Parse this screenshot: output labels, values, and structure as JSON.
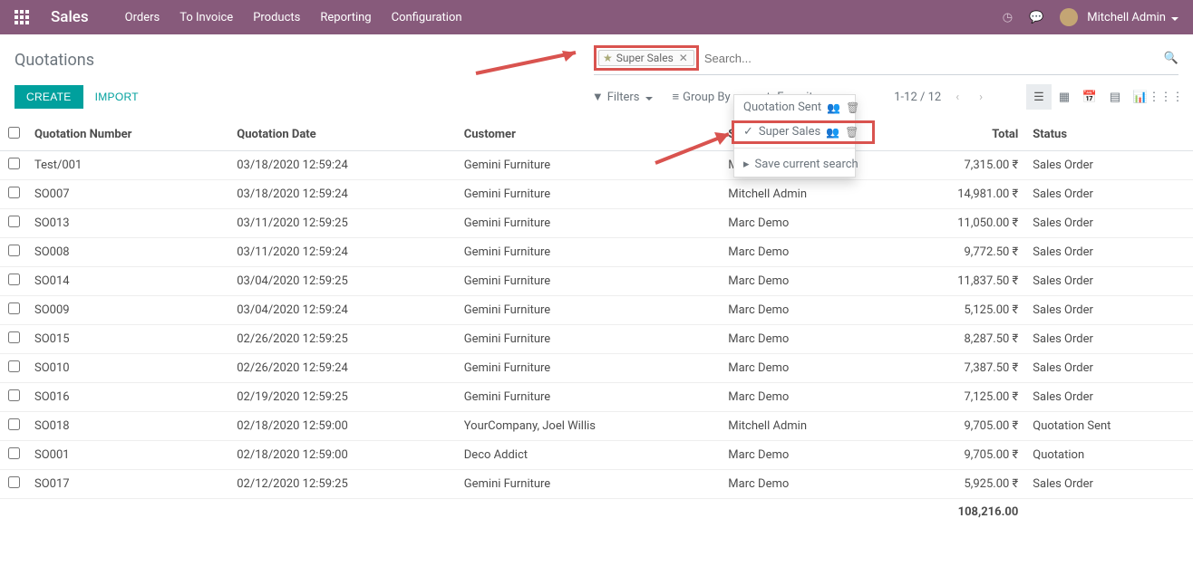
{
  "brand": "Sales",
  "topnav": [
    "Orders",
    "To Invoice",
    "Products",
    "Reporting",
    "Configuration"
  ],
  "user": "Mitchell Admin",
  "breadcrumb": "Quotations",
  "buttons": {
    "create": "CREATE",
    "import": "IMPORT"
  },
  "search": {
    "facet": "Super Sales",
    "placeholder": "Search..."
  },
  "filters": {
    "filters": "Filters",
    "groupby": "Group By",
    "favorites": "Favorites"
  },
  "pager": {
    "range": "1-12 / 12"
  },
  "favorites_menu": {
    "item1": "Quotation Sent",
    "item2": "Super Sales",
    "save": "Save current search"
  },
  "columns": {
    "number": "Quotation Number",
    "date": "Quotation Date",
    "customer": "Customer",
    "salesperson": "S",
    "total": "Total",
    "status": "Status"
  },
  "rows": [
    {
      "n": "Test/001",
      "d": "03/18/2020 12:59:24",
      "c": "Gemini Furniture",
      "s": "M",
      "t": "7,315.00 ₹",
      "st": "Sales Order"
    },
    {
      "n": "SO007",
      "d": "03/18/2020 12:59:24",
      "c": "Gemini Furniture",
      "s": "Mitchell Admin",
      "t": "14,981.00 ₹",
      "st": "Sales Order"
    },
    {
      "n": "SO013",
      "d": "03/11/2020 12:59:25",
      "c": "Gemini Furniture",
      "s": "Marc Demo",
      "t": "11,050.00 ₹",
      "st": "Sales Order"
    },
    {
      "n": "SO008",
      "d": "03/11/2020 12:59:24",
      "c": "Gemini Furniture",
      "s": "Marc Demo",
      "t": "9,772.50 ₹",
      "st": "Sales Order"
    },
    {
      "n": "SO014",
      "d": "03/04/2020 12:59:25",
      "c": "Gemini Furniture",
      "s": "Marc Demo",
      "t": "11,837.50 ₹",
      "st": "Sales Order"
    },
    {
      "n": "SO009",
      "d": "03/04/2020 12:59:24",
      "c": "Gemini Furniture",
      "s": "Marc Demo",
      "t": "5,125.00 ₹",
      "st": "Sales Order"
    },
    {
      "n": "SO015",
      "d": "02/26/2020 12:59:25",
      "c": "Gemini Furniture",
      "s": "Marc Demo",
      "t": "8,287.50 ₹",
      "st": "Sales Order"
    },
    {
      "n": "SO010",
      "d": "02/26/2020 12:59:24",
      "c": "Gemini Furniture",
      "s": "Marc Demo",
      "t": "7,387.50 ₹",
      "st": "Sales Order"
    },
    {
      "n": "SO016",
      "d": "02/19/2020 12:59:25",
      "c": "Gemini Furniture",
      "s": "Marc Demo",
      "t": "7,125.00 ₹",
      "st": "Sales Order"
    },
    {
      "n": "SO018",
      "d": "02/18/2020 12:59:00",
      "c": "YourCompany, Joel Willis",
      "s": "Mitchell Admin",
      "t": "9,705.00 ₹",
      "st": "Quotation Sent"
    },
    {
      "n": "SO001",
      "d": "02/18/2020 12:59:00",
      "c": "Deco Addict",
      "s": "Marc Demo",
      "t": "9,705.00 ₹",
      "st": "Quotation"
    },
    {
      "n": "SO017",
      "d": "02/12/2020 12:59:25",
      "c": "Gemini Furniture",
      "s": "Marc Demo",
      "t": "5,925.00 ₹",
      "st": "Sales Order"
    }
  ],
  "total": "108,216.00"
}
